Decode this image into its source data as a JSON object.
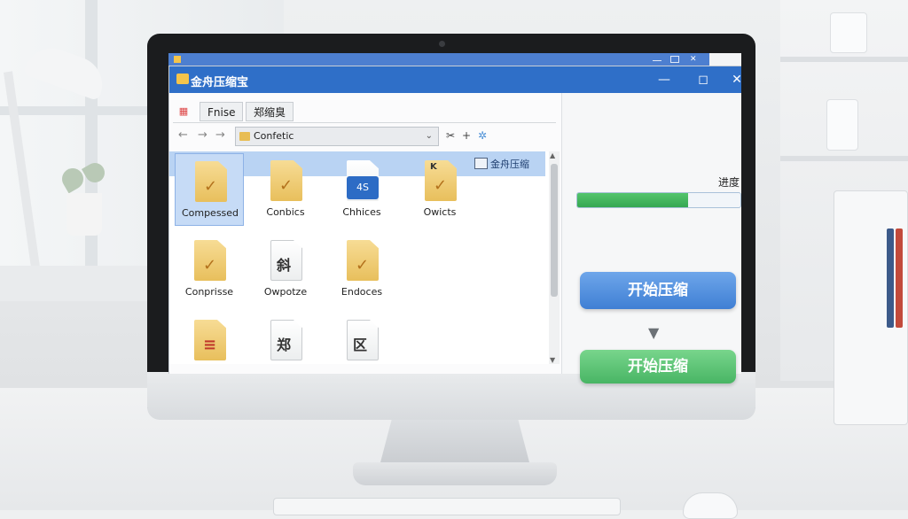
{
  "app": {
    "title": "金舟压缩宝"
  },
  "titlebar": {
    "minimize": "—",
    "maximize": "◻",
    "close": "✕"
  },
  "tabs": [
    {
      "label": "Fnise"
    },
    {
      "label": "郑缩臭"
    }
  ],
  "address": {
    "path": "Confetic",
    "back": "←",
    "forward": "→",
    "up": "→"
  },
  "selection_strip": {
    "label": "金舟压缩"
  },
  "files": [
    {
      "label": "Compessed",
      "icon": "folder-zip-icon"
    },
    {
      "label": "Conbics",
      "icon": "folder-zip-icon"
    },
    {
      "label": "Chhices",
      "icon": "archive-badge-icon",
      "badge": "4S"
    },
    {
      "label": "Owicts",
      "icon": "folder-zip-icon",
      "badge": "K"
    },
    {
      "label": "Conprisse",
      "icon": "folder-zip-icon"
    },
    {
      "label": "Owpotze",
      "icon": "document-icon",
      "glyph": "斜"
    },
    {
      "label": "Endoces",
      "icon": "folder-zip-icon"
    },
    {
      "label": "",
      "icon": "folder-zip-icon"
    },
    {
      "label": "",
      "icon": "document-icon",
      "glyph": "郑"
    },
    {
      "label": "",
      "icon": "document-icon",
      "glyph": "区"
    }
  ],
  "progress": {
    "label": "进度",
    "value": 0.68
  },
  "buttons": {
    "start_blue": "开始压缩",
    "start_green": "开始压缩"
  },
  "colors": {
    "titlebar": "#2f6fc8",
    "progress": "#3fb15a",
    "btn_blue": "#4f8ddc",
    "btn_green": "#55bd6e"
  }
}
